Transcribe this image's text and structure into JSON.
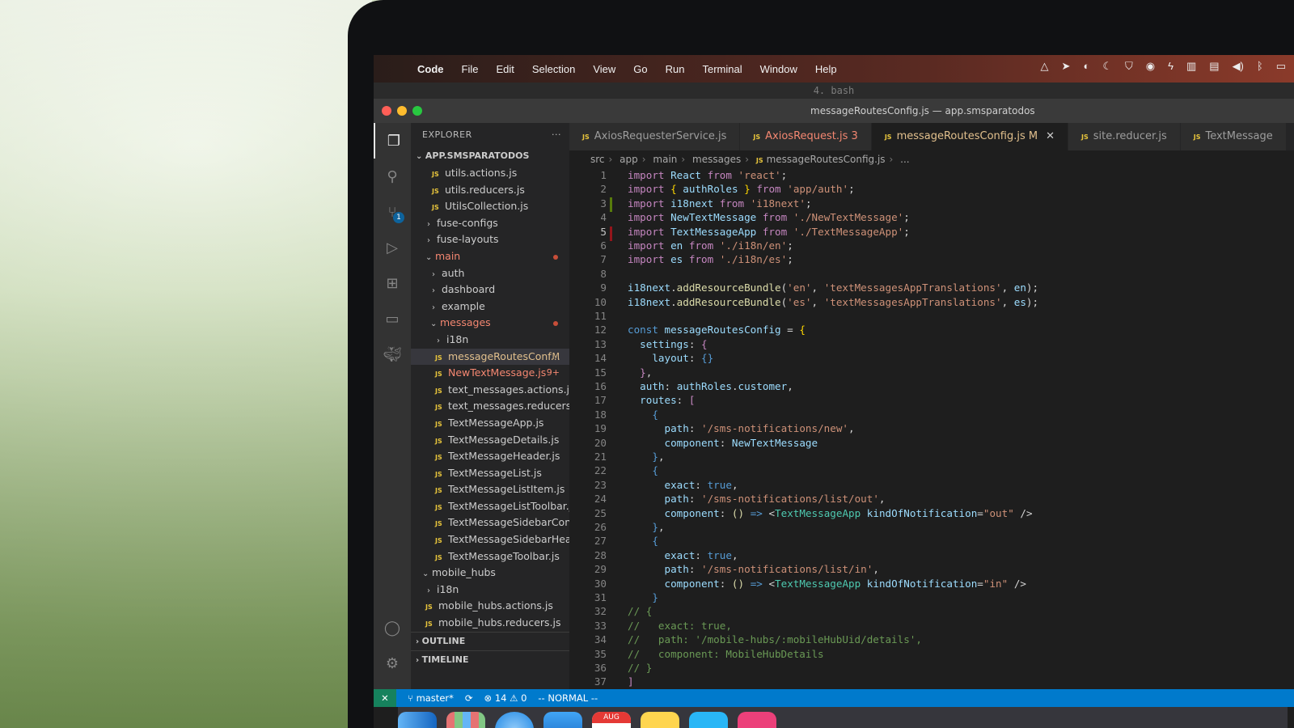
{
  "menubar": {
    "app": "Code",
    "items": [
      "File",
      "Edit",
      "Selection",
      "View",
      "Go",
      "Run",
      "Terminal",
      "Window",
      "Help"
    ]
  },
  "terminal_title": "4. bash",
  "window_title": "messageRoutesConfig.js — app.smsparatodos",
  "explorer": {
    "heading": "EXPLORER",
    "more": "···",
    "root": "APP.SMSPARATODOS",
    "rows": [
      {
        "label": "utils.actions.js"
      },
      {
        "label": "utils.reducers.js"
      },
      {
        "label": "UtilsCollection.js"
      },
      {
        "label": "fuse-configs"
      },
      {
        "label": "fuse-layouts"
      },
      {
        "label": "main"
      },
      {
        "label": "auth"
      },
      {
        "label": "dashboard"
      },
      {
        "label": "example"
      },
      {
        "label": "messages"
      },
      {
        "label": "i18n"
      },
      {
        "label": "messageRoutesConf...",
        "flag": "M"
      },
      {
        "label": "NewTextMessage.js",
        "flag": "9+"
      },
      {
        "label": "text_messages.actions.js"
      },
      {
        "label": "text_messages.reducers.js"
      },
      {
        "label": "TextMessageApp.js"
      },
      {
        "label": "TextMessageDetails.js"
      },
      {
        "label": "TextMessageHeader.js"
      },
      {
        "label": "TextMessageList.js"
      },
      {
        "label": "TextMessageListItem.js"
      },
      {
        "label": "TextMessageListToolbar.js"
      },
      {
        "label": "TextMessageSidebarCont..."
      },
      {
        "label": "TextMessageSidebarHea..."
      },
      {
        "label": "TextMessageToolbar.js"
      },
      {
        "label": "mobile_hubs"
      },
      {
        "label": "i18n"
      },
      {
        "label": "mobile_hubs.actions.js"
      },
      {
        "label": "mobile_hubs.reducers.js"
      }
    ],
    "outline": "OUTLINE",
    "timeline": "TIMELINE"
  },
  "scm_badge": "1",
  "tabs": [
    {
      "label": "AxiosRequesterService.js",
      "extra": ""
    },
    {
      "label": "AxiosRequest.js",
      "extra": "3"
    },
    {
      "label": "messageRoutesConfig.js",
      "extra": "M"
    },
    {
      "label": "site.reducer.js",
      "extra": ""
    },
    {
      "label": "TextMessage",
      "extra": ""
    }
  ],
  "tab_file_badge": "JS",
  "breadcrumb": [
    "src",
    "app",
    "main",
    "messages",
    "messageRoutesConfig.js",
    "..."
  ],
  "line_numbers": [
    "1",
    "2",
    "3",
    "4",
    "5",
    "6",
    "7",
    "8",
    "9",
    "10",
    "11",
    "12",
    "13",
    "14",
    "15",
    "16",
    "17",
    "18",
    "19",
    "20",
    "21",
    "22",
    "23",
    "24",
    "25",
    "26",
    "27",
    "28",
    "29",
    "30",
    "31",
    "32",
    "33",
    "34",
    "35",
    "36",
    "37"
  ],
  "code": {
    "react": "'react'",
    "authRoles": "authRoles",
    "app_auth": "'app/auth'",
    "i18next_str": "'i18next'",
    "NewTextMessage": "NewTextMessage",
    "newtm_path": "'./NewTextMessage'",
    "TextMessageApp": "TextMessageApp",
    "tma_path": "'./TextMessageApp'",
    "en_path": "'./i18n/en'",
    "es_path": "'./i18n/es'",
    "addRB": "addResourceBundle",
    "en_code": "'en'",
    "es_code": "'es'",
    "translations": "'textMessagesAppTranslations'",
    "config_name": "messageRoutesConfig",
    "customer": "customer",
    "path_new": "'/sms-notifications/new'",
    "path_out": "'/sms-notifications/list/out'",
    "path_in": "'/sms-notifications/list/in'",
    "kind_attr": "kindOfNotification",
    "out_val": "\"out\"",
    "in_val": "\"in\"",
    "c32": "// {",
    "c33": "//   exact: true,",
    "c34": "//   path: '/mobile-hubs/:mobileHubUid/details',",
    "c35": "//   component: MobileHubDetails",
    "c36": "// }"
  },
  "statusbar": {
    "branch": "master*",
    "errors": "14",
    "warnings": "0",
    "mode": "-- NORMAL --"
  },
  "dock": {
    "calendar_month": "AUG"
  },
  "colors": {
    "accent": "#007acc",
    "modified": "#e2c08d",
    "error": "#f48771"
  }
}
